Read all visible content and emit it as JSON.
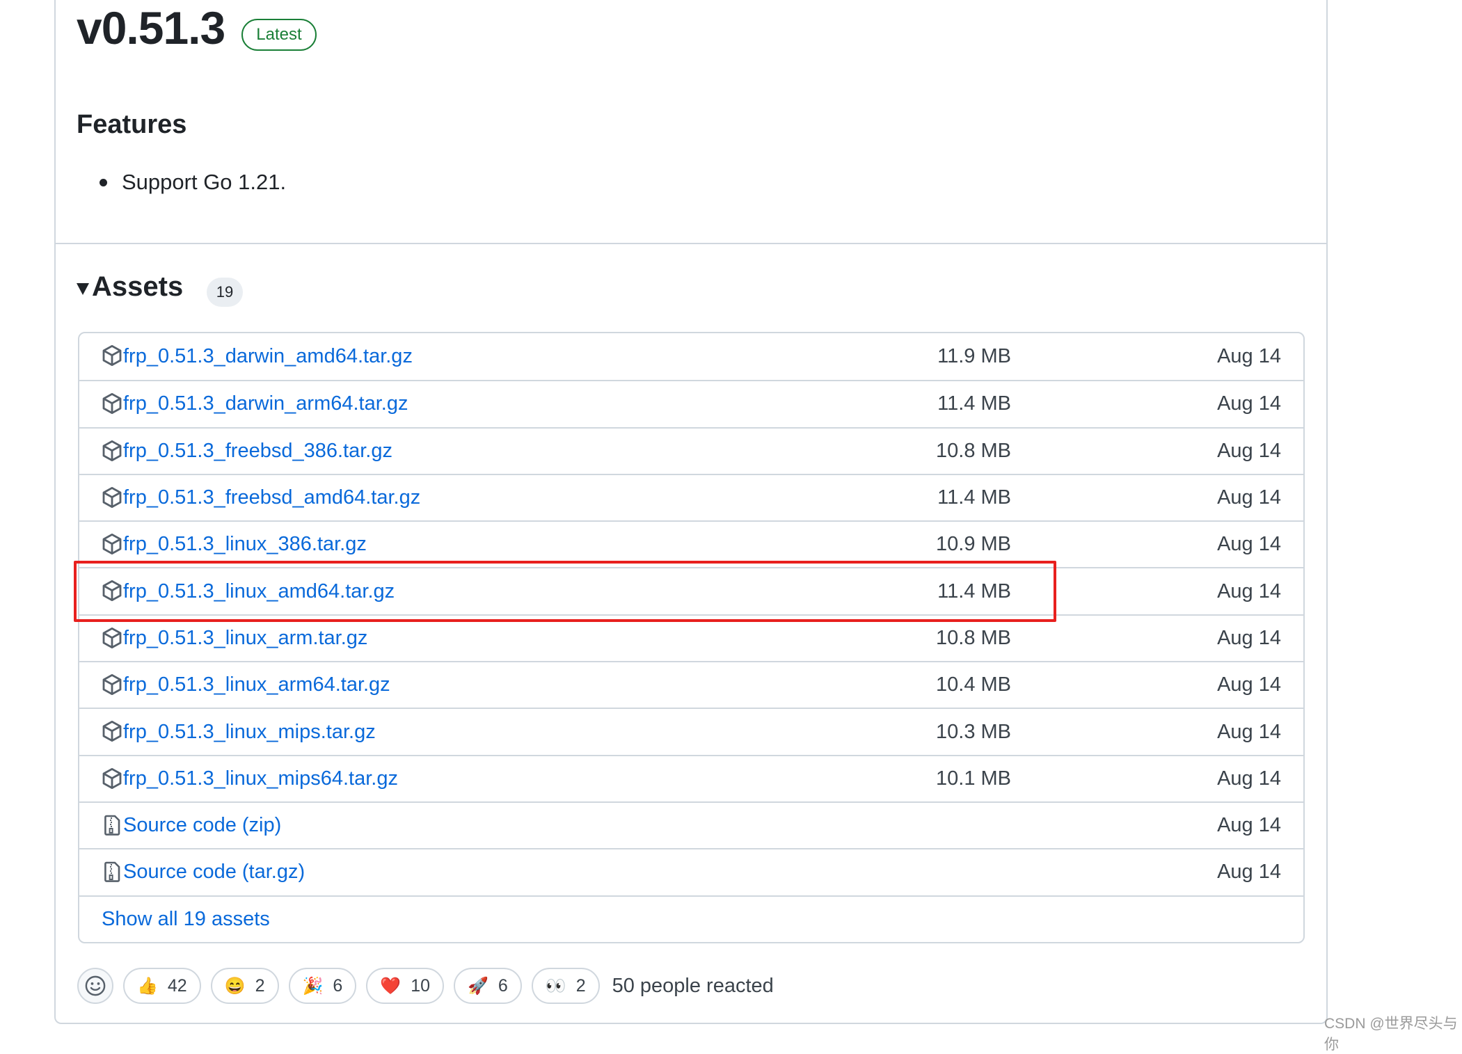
{
  "release": {
    "title": "v0.51.3",
    "badge": "Latest",
    "features_heading": "Features",
    "features": [
      "Support Go 1.21."
    ]
  },
  "assets": {
    "heading": "Assets",
    "count": "19",
    "items": [
      {
        "name": "frp_0.51.3_darwin_amd64.tar.gz",
        "size": "11.9 MB",
        "date": "Aug 14",
        "icon": "package-icon"
      },
      {
        "name": "frp_0.51.3_darwin_arm64.tar.gz",
        "size": "11.4 MB",
        "date": "Aug 14",
        "icon": "package-icon"
      },
      {
        "name": "frp_0.51.3_freebsd_386.tar.gz",
        "size": "10.8 MB",
        "date": "Aug 14",
        "icon": "package-icon"
      },
      {
        "name": "frp_0.51.3_freebsd_amd64.tar.gz",
        "size": "11.4 MB",
        "date": "Aug 14",
        "icon": "package-icon"
      },
      {
        "name": "frp_0.51.3_linux_386.tar.gz",
        "size": "10.9 MB",
        "date": "Aug 14",
        "icon": "package-icon"
      },
      {
        "name": "frp_0.51.3_linux_amd64.tar.gz",
        "size": "11.4 MB",
        "date": "Aug 14",
        "icon": "package-icon",
        "highlighted": true
      },
      {
        "name": "frp_0.51.3_linux_arm.tar.gz",
        "size": "10.8 MB",
        "date": "Aug 14",
        "icon": "package-icon"
      },
      {
        "name": "frp_0.51.3_linux_arm64.tar.gz",
        "size": "10.4 MB",
        "date": "Aug 14",
        "icon": "package-icon"
      },
      {
        "name": "frp_0.51.3_linux_mips.tar.gz",
        "size": "10.3 MB",
        "date": "Aug 14",
        "icon": "package-icon"
      },
      {
        "name": "frp_0.51.3_linux_mips64.tar.gz",
        "size": "10.1 MB",
        "date": "Aug 14",
        "icon": "package-icon"
      },
      {
        "name": "Source code",
        "ext": "(zip)",
        "size": "",
        "date": "Aug 14",
        "icon": "file-zip-icon"
      },
      {
        "name": "Source code",
        "ext": "(tar.gz)",
        "size": "",
        "date": "Aug 14",
        "icon": "file-zip-icon"
      }
    ],
    "show_all": "Show all 19 assets"
  },
  "reactions": {
    "items": [
      {
        "emoji": "👍",
        "name": "thumbs-up",
        "count": "42"
      },
      {
        "emoji": "😄",
        "name": "laugh",
        "count": "2"
      },
      {
        "emoji": "🎉",
        "name": "hooray",
        "count": "6"
      },
      {
        "emoji": "❤️",
        "name": "heart",
        "count": "10"
      },
      {
        "emoji": "🚀",
        "name": "rocket",
        "count": "6"
      },
      {
        "emoji": "👀",
        "name": "eyes",
        "count": "2"
      }
    ],
    "summary": "50 people reacted"
  },
  "watermark": "CSDN @世界尽头与你",
  "colors": {
    "link": "#0969da",
    "latest": "#1a7f37",
    "highlight": "#e8201e",
    "border": "#d0d7de"
  }
}
